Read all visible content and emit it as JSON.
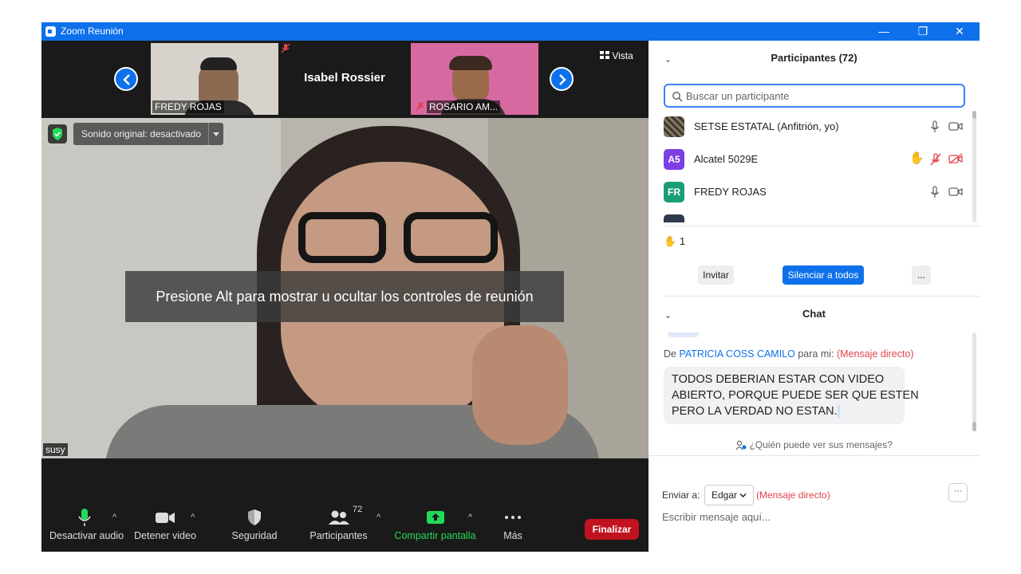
{
  "window": {
    "title": "Zoom Reunión",
    "controls": {
      "minimize": "—",
      "restore": "❐",
      "close": "✕"
    }
  },
  "strip": {
    "thumbnails": [
      {
        "name": "FREDY ROJAS"
      },
      {
        "name": "Isabel Rossier"
      },
      {
        "name": "ROSARIO AM..."
      }
    ],
    "view_label": "Vista"
  },
  "main_video": {
    "sound_label": "Sonido original: desactivado",
    "overlay_text": "Presione Alt para mostrar u ocultar los controles de reunión",
    "speaker_name": "susy"
  },
  "toolbar": {
    "audio": "Desactivar audio",
    "video": "Detener video",
    "security": "Seguridad",
    "participants": "Participantes",
    "participants_count": "72",
    "share": "Compartir pantalla",
    "more": "Más",
    "end": "Finalizar"
  },
  "participants_panel": {
    "title": "Participantes (72)",
    "search_placeholder": "Buscar un participante",
    "rows": [
      {
        "initials": "",
        "name": "SETSE ESTATAL (Anfitrión, yo)"
      },
      {
        "initials": "A5",
        "name": "Alcatel 5029E"
      },
      {
        "initials": "FR",
        "name": "FREDY ROJAS"
      }
    ],
    "raised_hands": "1",
    "invite": "Invitar",
    "mute_all": "Silenciar a todos",
    "more": "..."
  },
  "chat": {
    "title": "Chat",
    "from_prefix": "De",
    "from_name": "PATRICIA COSS CAMILO",
    "to_me": "para mi:",
    "direct": "(Mensaje directo)",
    "message_lines": [
      "TODOS DEBERIAN ESTAR CON VIDEO",
      "ABIERTO, PORQUE PUEDE SER QUE ESTEN",
      "PERO LA VERDAD NO ESTAN."
    ],
    "who_can_see": "¿Quién puede ver sus mensajes?",
    "send_to_label": "Enviar a:",
    "recipient": "Edgar",
    "recipient_mode": "(Mensaje directo)",
    "options": "···",
    "input_placeholder": "Escribir mensaje aquí..."
  },
  "colors": {
    "zoom_blue": "#0e71eb",
    "end_red": "#c1121f",
    "share_green": "#23d959",
    "direct_red": "#e0454a",
    "avatar_purple": "#7b3fe4",
    "avatar_teal": "#1b9e77"
  }
}
